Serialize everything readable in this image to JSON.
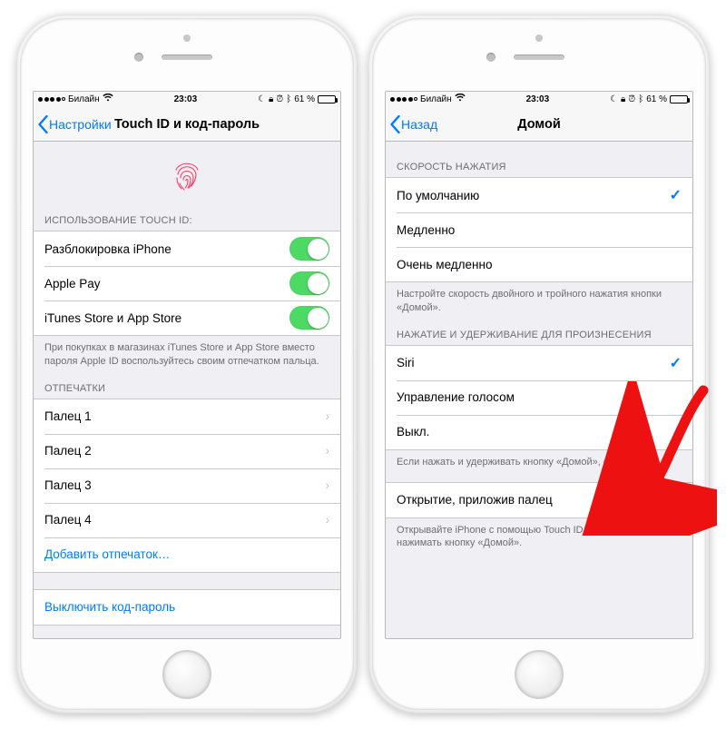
{
  "status": {
    "carrier": "Билайн",
    "time": "23:03",
    "battery": "61 %"
  },
  "left": {
    "nav": {
      "back": "Настройки",
      "title": "Touch ID и код-пароль"
    },
    "touchid_header": "ИСПОЛЬЗОВАНИЕ TOUCH ID:",
    "toggles": [
      {
        "label": "Разблокировка iPhone",
        "on": true
      },
      {
        "label": "Apple Pay",
        "on": true
      },
      {
        "label": "iTunes Store и App Store",
        "on": true
      }
    ],
    "touchid_footer": "При покупках в магазинах iTunes Store и App Store вместо пароля Apple ID воспользуйтесь своим отпечатком пальца.",
    "fingerprints_header": "ОТПЕЧАТКИ",
    "fingers": [
      "Палец 1",
      "Палец 2",
      "Палец 3",
      "Палец 4"
    ],
    "add_fp": "Добавить отпечаток…",
    "disable": "Выключить код-пароль"
  },
  "right": {
    "nav": {
      "back": "Назад",
      "title": "Домой"
    },
    "speed_header": "СКОРОСТЬ НАЖАТИЯ",
    "speed_options": [
      {
        "label": "По умолчанию",
        "checked": true
      },
      {
        "label": "Медленно",
        "checked": false
      },
      {
        "label": "Очень медленно",
        "checked": false
      }
    ],
    "speed_footer": "Настройте скорость двойного и тройного нажатия кнопки «Домой».",
    "hold_header": "НАЖАТИЕ И УДЕРЖИВАНИЕ ДЛЯ ПРОИЗНЕСЕНИЯ",
    "hold_options": [
      {
        "label": "Siri",
        "checked": true
      },
      {
        "label": "Управление голосом",
        "checked": false
      },
      {
        "label": "Выкл.",
        "checked": false
      }
    ],
    "hold_footer": "Если нажать и удерживать кнопку «Домой», ответит Siri.",
    "rest_label": "Открытие, приложив палец",
    "rest_footer": "Открывайте iPhone с помощью Touch ID, без необходимости нажимать кнопку «Домой»."
  }
}
